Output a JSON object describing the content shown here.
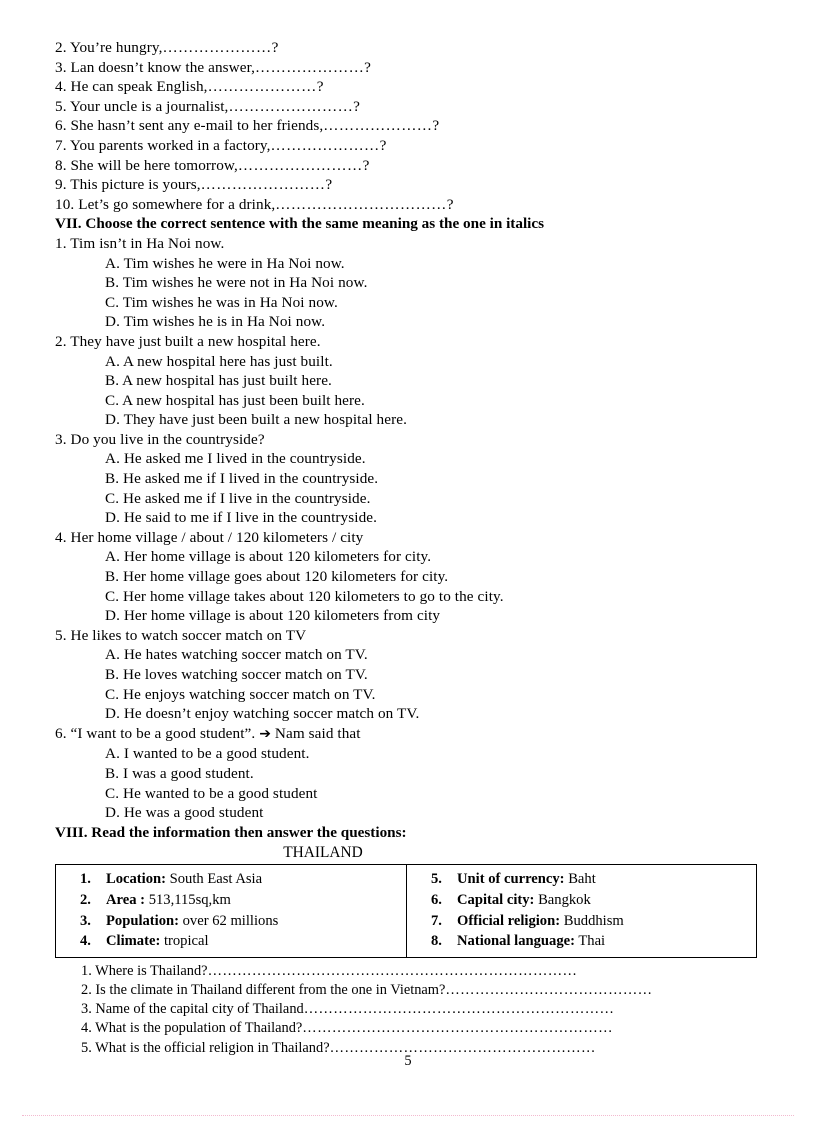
{
  "document": {
    "page_number": "5"
  },
  "tag_questions": {
    "items": [
      {
        "number": "2.",
        "text": "You’re hungry,",
        "dots": "…………………",
        "end": "?"
      },
      {
        "number": "3.",
        "text": "Lan doesn’t know the answer,",
        "dots": "…………………",
        "end": "?"
      },
      {
        "number": "4.",
        "text": "He can speak English,",
        "dots": "…………………",
        "end": "?"
      },
      {
        "number": "5.",
        "text": "Your uncle is a journalist,",
        "dots": "……………………",
        "end": "?"
      },
      {
        "number": "6.",
        "text": "She hasn’t sent any e-mail to her friends,",
        "dots": "…………………",
        "end": "?"
      },
      {
        "number": "7.",
        "text": "You parents worked in a factory,",
        "dots": "…………………",
        "end": "?"
      },
      {
        "number": "8.",
        "text": "She will be here tomorrow,",
        "dots": "……………………",
        "end": "?"
      },
      {
        "number": "9.",
        "text": "This picture is yours,",
        "dots": "……………………",
        "end": "?"
      },
      {
        "number": "10.",
        "text": "Let’s go somewhere for a drink,",
        "dots": "……………………………",
        "end": "?"
      }
    ]
  },
  "section_vii": {
    "heading": "VII. Choose the correct sentence with  the same meaning as the one in italics",
    "questions": [
      {
        "number": "1.",
        "stem": "Tim isn’t in Ha Noi now.",
        "options": [
          "A. Tim wishes he were in Ha Noi now.",
          "B. Tim wishes he were not in Ha Noi now.",
          "C. Tim wishes he was in Ha Noi now.",
          "D. Tim wishes he is in Ha Noi now."
        ]
      },
      {
        "number": "2.",
        "stem": "They have just built a new hospital here.",
        "options": [
          "A. A new hospital here has just built.",
          "B. A new hospital has just built here.",
          "C. A new hospital has just been built here.",
          "D. They have just been built a new hospital here."
        ]
      },
      {
        "number": "3.",
        "stem": "Do you live in the countryside?",
        "options": [
          "A. He asked me I lived in the countryside.",
          "B. He asked me if I lived in the countryside.",
          "C. He asked me if I live in the countryside.",
          "D. He said to me if I live in the countryside."
        ]
      },
      {
        "number": "4.",
        "stem": "Her home village  / about / 120 kilometers  / city",
        "options": [
          "A. Her home village is about 120 kilometers for city.",
          "B. Her home village goes about 120 kilometers for city.",
          "C. Her home village takes about 120 kilometers to go to the city.",
          "D. Her home village is about 120 kilometers from city"
        ]
      },
      {
        "number": "5.",
        "stem": "He likes to watch soccer match on TV",
        "options": [
          "A. He hates watching soccer match on TV.",
          "B. He loves watching soccer match on TV.",
          "C. He enjoys watching soccer match on TV.",
          "D. He doesn’t enjoy watching soccer match on TV."
        ]
      },
      {
        "number": "6.",
        "stem_before_arrow": "“I want to be a good student”.",
        "arrow": "➔",
        "stem_after_arrow": "Nam said that",
        "options": [
          "A.  I wanted to be a good student.",
          "B.  I was a good student.",
          "C.  He wanted to be a good student",
          "D.  He was a good student"
        ]
      }
    ]
  },
  "section_viii": {
    "heading": "VIII. Read the information  then answer the questions:",
    "table_title": "THAILAND",
    "facts_left": [
      {
        "num": "1.",
        "label": "Location:",
        "value": "South East Asia"
      },
      {
        "num": "2.",
        "label": "Area :",
        "value": "513,115sq,km"
      },
      {
        "num": "3.",
        "label": "Population:",
        "value": " over 62 millions"
      },
      {
        "num": "4.",
        "label": "Climate:",
        "value": "tropical"
      }
    ],
    "facts_right": [
      {
        "num": "5.",
        "label": "Unit of currency:",
        "value": "Baht"
      },
      {
        "num": "6.",
        "label": "Capital city:",
        "value": "Bangkok"
      },
      {
        "num": "7.",
        "label": "Official religion:",
        "value": "Buddhism"
      },
      {
        "num": "8.",
        "label": "National language:",
        "value": "Thai"
      }
    ],
    "questions": [
      {
        "number": "1.",
        "text": "Where is Thailand?",
        "dots": "…………………………………………………………………"
      },
      {
        "number": "2.",
        "text": "Is the climate in Thailand different from the one in Vietnam?",
        "dots": "……………………………………"
      },
      {
        "number": "3.",
        "text": "Name of the capital city of Thailand",
        "dots": "………………………………………………………"
      },
      {
        "number": "4.",
        "text": "What is the population of Thailand?",
        "dots": "………………………………………………………"
      },
      {
        "number": "5.",
        "text": "What is the official religion in Thailand?",
        "dots": "………………………………………………"
      }
    ]
  },
  "colors": {
    "text": "#000000",
    "table_border": "#000000",
    "footer_rule": "#f3b9cf"
  }
}
